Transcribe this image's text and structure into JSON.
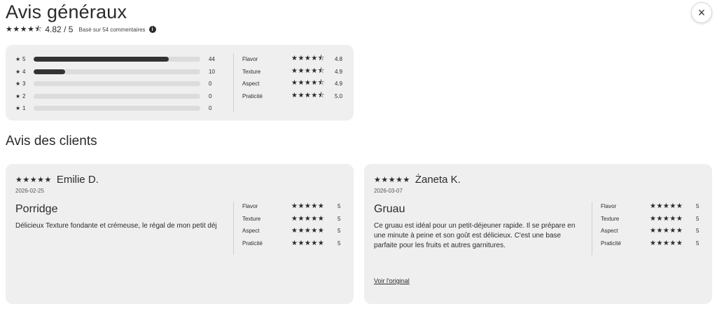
{
  "header": {
    "title": "Avis généraux",
    "close_icon": "×",
    "stars": "★★★★⯪",
    "rating": "4.82 / 5",
    "based_on": "Basé sur 54 commentaires",
    "info_icon": "i"
  },
  "distribution": [
    {
      "star": "5",
      "count": "44",
      "fill": 0.81
    },
    {
      "star": "4",
      "count": "10",
      "fill": 0.19
    },
    {
      "star": "3",
      "count": "0",
      "fill": 0
    },
    {
      "star": "2",
      "count": "0",
      "fill": 0
    },
    {
      "star": "1",
      "count": "0",
      "fill": 0
    }
  ],
  "star_glyph": "★",
  "attributes": [
    {
      "name": "Flavor",
      "stars": "★★★★⯪",
      "value": "4.8"
    },
    {
      "name": "Texture",
      "stars": "★★★★⯪",
      "value": "4.9"
    },
    {
      "name": "Aspect",
      "stars": "★★★★⯪",
      "value": "4.9"
    },
    {
      "name": "Praticité",
      "stars": "★★★★⯪",
      "value": "5.0"
    }
  ],
  "section_title": "Avis des clients",
  "reviews": [
    {
      "stars": "★★★★★",
      "name": "Emilie D.",
      "date": "2026-02-25",
      "title": "Porridge",
      "body": "Délicieux Texture fondante et crémeuse, le régal de mon petit déj",
      "link": "",
      "ratings": [
        {
          "name": "Flavor",
          "stars": "★★★★★",
          "value": "5"
        },
        {
          "name": "Texture",
          "stars": "★★★★★",
          "value": "5"
        },
        {
          "name": "Aspect",
          "stars": "★★★★★",
          "value": "5"
        },
        {
          "name": "Praticité",
          "stars": "★★★★★",
          "value": "5"
        }
      ]
    },
    {
      "stars": "★★★★★",
      "name": "Żaneta K.",
      "date": "2026-03-07",
      "title": "Gruau",
      "body": "Ce gruau est idéal pour un petit-déjeuner rapide. Il se prépare en une minute à peine et son goût est délicieux. C'est une base parfaite pour les fruits et autres garnitures.",
      "link": "Voir l'original",
      "ratings": [
        {
          "name": "Flavor",
          "stars": "★★★★★",
          "value": "5"
        },
        {
          "name": "Texture",
          "stars": "★★★★★",
          "value": "5"
        },
        {
          "name": "Aspect",
          "stars": "★★★★★",
          "value": "5"
        },
        {
          "name": "Praticité",
          "stars": "★★★★★",
          "value": "5"
        }
      ]
    }
  ]
}
